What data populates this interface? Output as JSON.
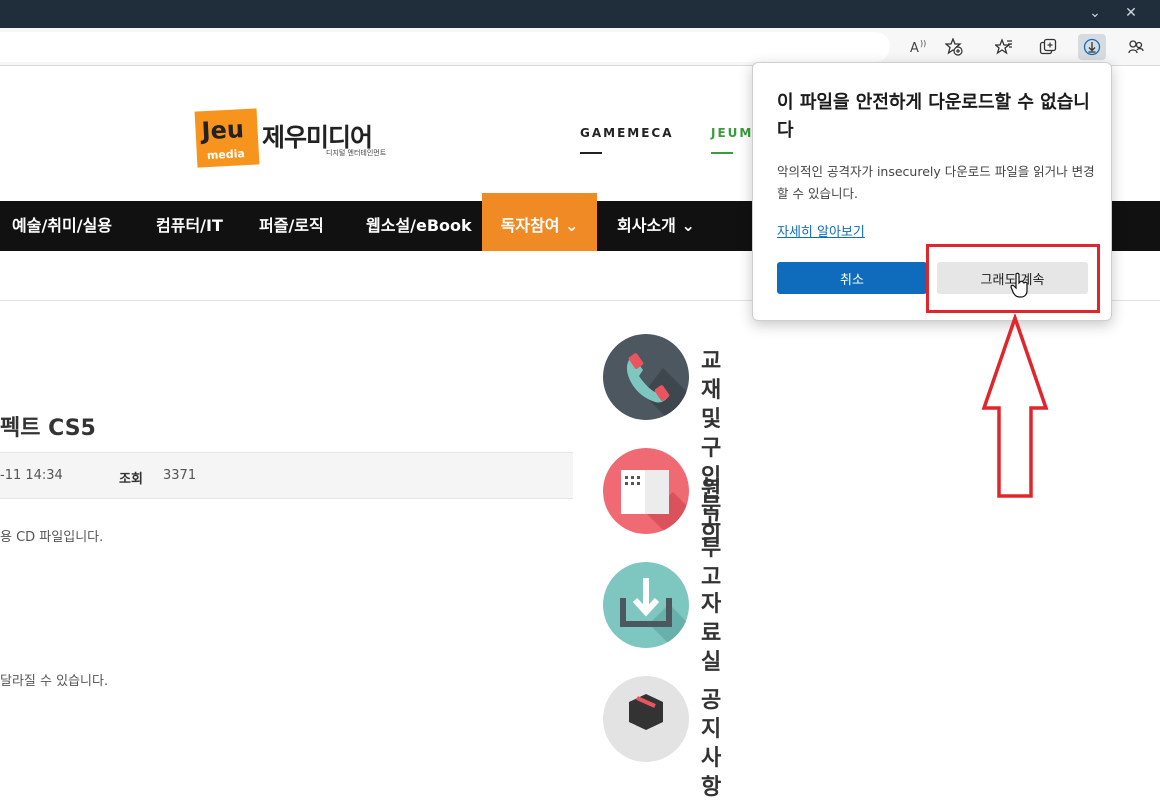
{
  "browser": {
    "colors": {
      "tabstrip": "#1f2e3a",
      "toolbar": "#f7f7f7"
    },
    "tab_controls": [
      "chevron-down-icon",
      "close-icon"
    ],
    "toolbar_icons": [
      "read-aloud-icon",
      "add-favorite-icon",
      "favorites-icon",
      "collections-icon",
      "downloads-icon",
      "extensions-icon"
    ]
  },
  "site": {
    "logo": {
      "mark_text": "Jeu",
      "mark_sub": "media",
      "name": "제우미디어",
      "tagline": "디지털 엔터테인먼트",
      "color": "#f7941d"
    },
    "partners": [
      {
        "label": "GAMEMECA",
        "color": "#222222"
      },
      {
        "label": "JEUMI",
        "color": "#3a9c3a"
      }
    ],
    "nav": [
      {
        "label": "예술/취미/실용"
      },
      {
        "label": "컴퓨터/IT"
      },
      {
        "label": "퍼즐/로직"
      },
      {
        "label": "웹소설/eBook"
      },
      {
        "label": "독자참여",
        "dropdown": true,
        "active": true,
        "color": "#f08a24"
      },
      {
        "label": "회사소개",
        "dropdown": true
      }
    ]
  },
  "article": {
    "title": "펙트 CS5",
    "meta": {
      "date": "-11 14:34",
      "views_label": "조회",
      "views": "3371"
    },
    "lines": [
      "용 CD 파일입니다.",
      "달라질 수 있습니다."
    ]
  },
  "sidebar": {
    "items": [
      {
        "label_line1": "교재 및",
        "label_line2": "구입문의",
        "icon": "phone-icon",
        "color": "#4d5760"
      },
      {
        "label_line1": "원고투고",
        "label_line2": "",
        "icon": "document-icon",
        "color": "#f06a73"
      },
      {
        "label_line1": "자료실",
        "label_line2": "",
        "icon": "download-tray-icon",
        "color": "#7ec7c1"
      },
      {
        "label_line1": "공지사항",
        "label_line2": "",
        "icon": "notice-box-icon",
        "color": "#e3e3e3"
      }
    ]
  },
  "download_warning": {
    "title": "이 파일을 안전하게 다운로드할 수 없습니다",
    "description": "악의적인 공격자가 insecurely 다운로드 파일을 읽거나 변경할 수 있습니다.",
    "learn_more": "자세히 알아보기",
    "cancel": "취소",
    "continue": "그래도 계속",
    "accent": "#0f6cbd"
  },
  "annotation": {
    "color": "#e0262b"
  }
}
